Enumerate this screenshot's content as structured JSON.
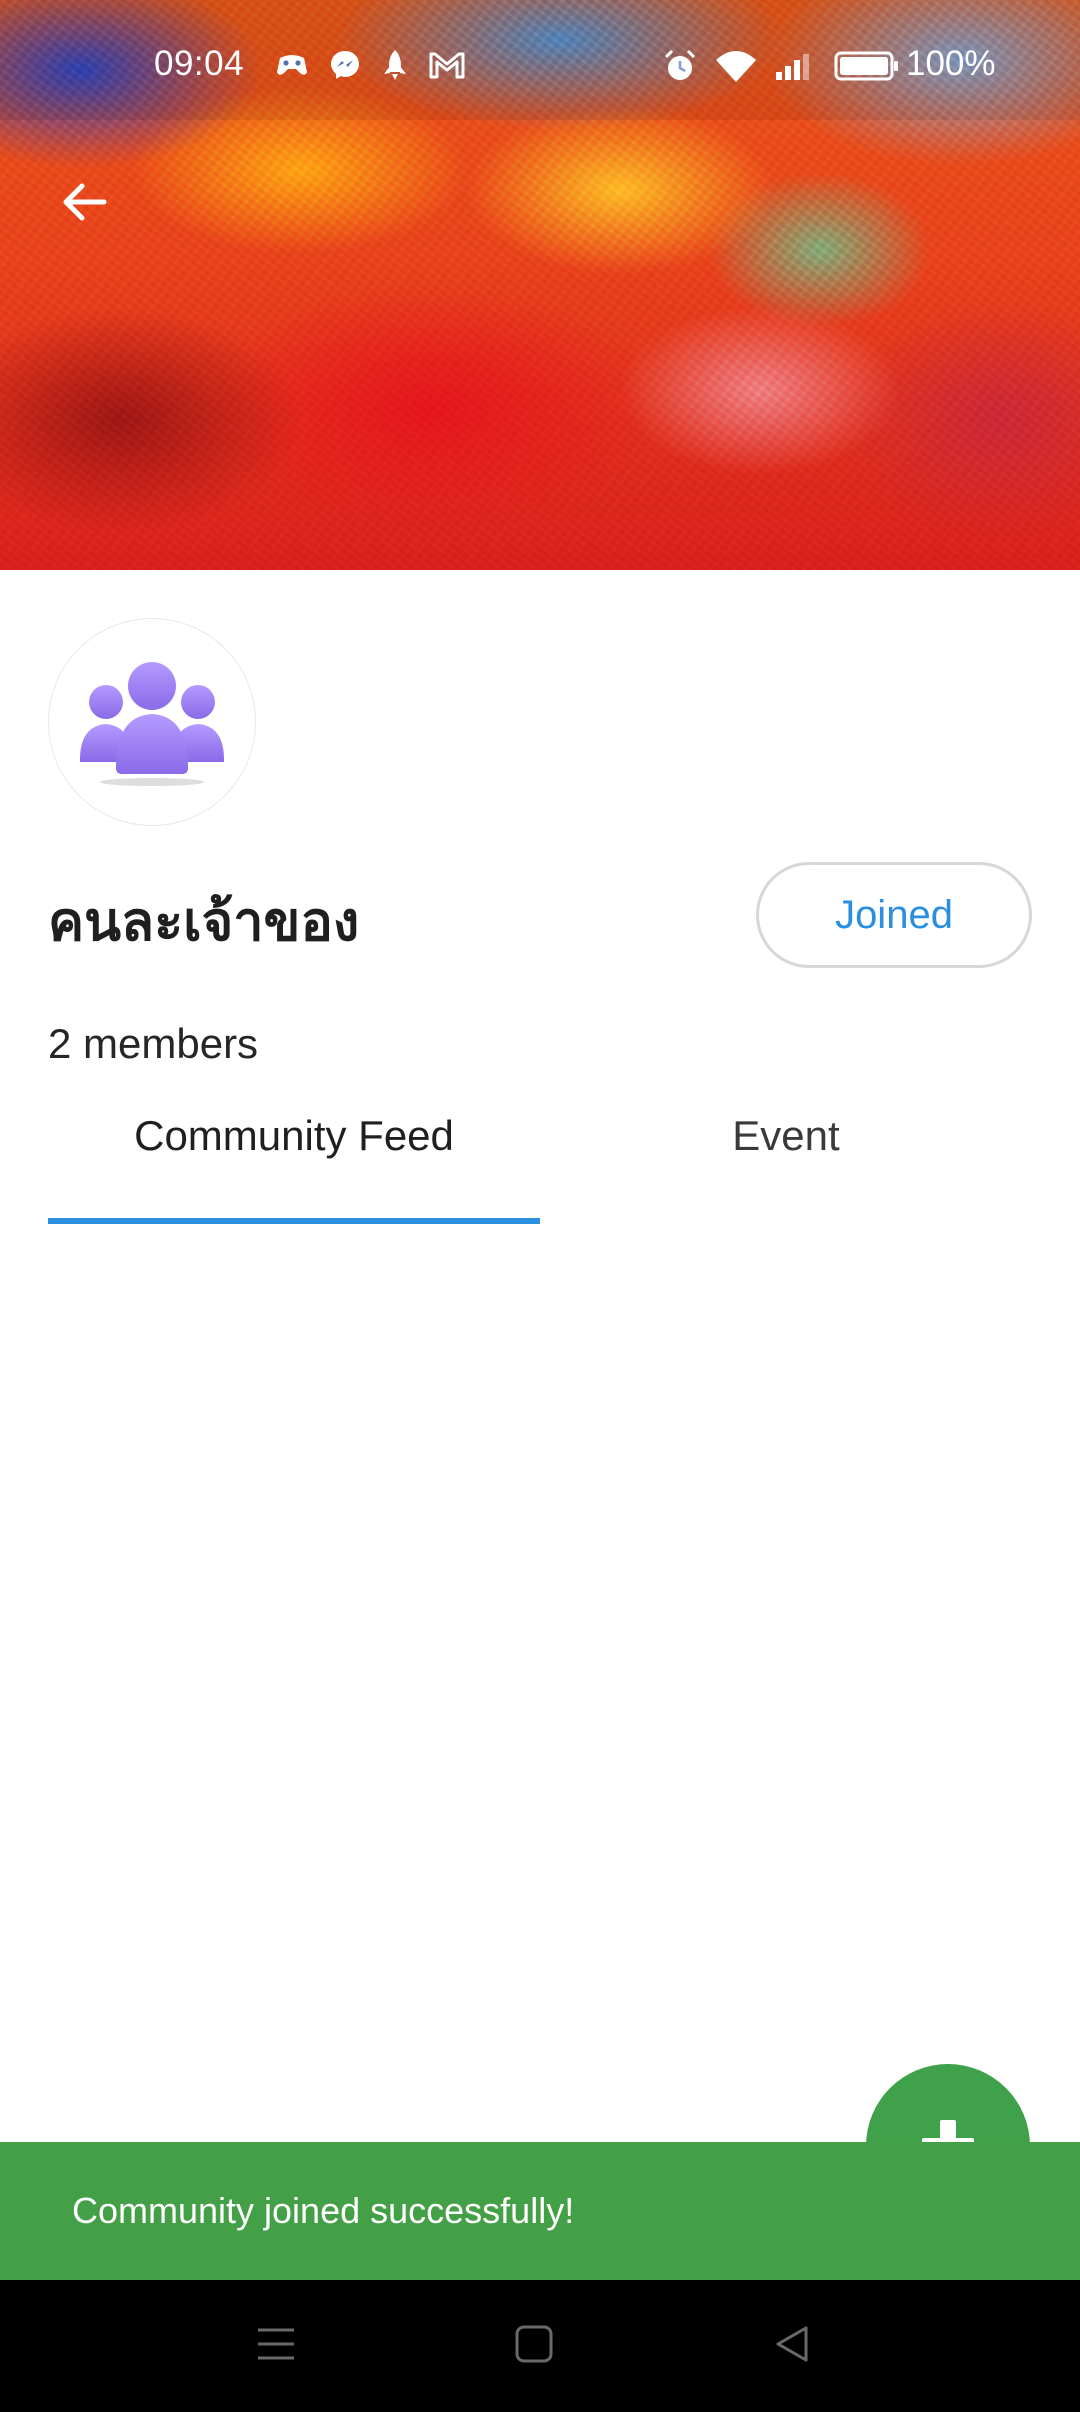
{
  "status_bar": {
    "time": "09:04",
    "battery": "100%",
    "left_icons": [
      "game-controller-icon",
      "messenger-icon",
      "rocket-icon",
      "gmail-icon"
    ],
    "right_icons": [
      "alarm-icon",
      "wifi-icon",
      "signal-icon",
      "battery-icon"
    ]
  },
  "header": {
    "back_icon": "arrow-left-icon"
  },
  "community": {
    "name": "คนละเจ้าของ",
    "join_label": "Joined",
    "members": "2 members",
    "avatar_icon": "group-icon"
  },
  "tabs": [
    {
      "label": "Community Feed",
      "active": true
    },
    {
      "label": "Event",
      "active": false
    }
  ],
  "fab": {
    "icon": "plus-icon"
  },
  "snackbar": {
    "message": "Community joined successfully!"
  },
  "nav_bar": {
    "icons": [
      "menu-icon",
      "home-icon",
      "back-icon"
    ]
  },
  "colors": {
    "accent": "#2a8fe0",
    "snackbar_bg": "#43a047",
    "fab_bg": "#3fa14a",
    "avatar_purple": "#9b7ff0"
  }
}
